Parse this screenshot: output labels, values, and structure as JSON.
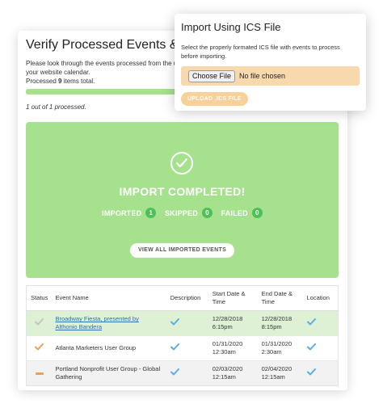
{
  "main": {
    "title": "Verify Processed Events & Import",
    "intro_line1": "Please look through the events processed from the uplo",
    "intro_line2": "your website calendar.",
    "processed_prefix": "Processed ",
    "processed_count": "9",
    "processed_suffix": " items total.",
    "progress_fraction": 1.0,
    "processed_status": "1 out of 1 processed."
  },
  "complete": {
    "title": "IMPORT COMPLETED!",
    "imported_label": "IMPORTED",
    "imported_count": "1",
    "skipped_label": "SKIPPED",
    "skipped_count": "0",
    "failed_label": "FAILED",
    "failed_count": "0",
    "view_button": "VIEW ALL IMPORTED EVENTS",
    "check_icon": "check-circle-icon"
  },
  "table": {
    "headers": {
      "status": "Status",
      "event_name": "Event Name",
      "description": "Description",
      "start_line1": "Start Date &",
      "start_line2": "Time",
      "end_line1": "End Date &",
      "end_line2": "Time",
      "location": "Location"
    },
    "rows": [
      {
        "status_icon": "check-icon",
        "name_line1": "Broadway Fiesta, presented by",
        "name_line2": "Althonio Bandera",
        "start_date": "12/28/2018",
        "start_time": "6:15pm",
        "end_date": "12/28/2018",
        "end_time": "8:15pm"
      },
      {
        "status_icon": "check-icon",
        "name_line1": "Atlanta Marketers User Group",
        "name_line2": "",
        "start_date": "01/31/2020",
        "start_time": "12:30am",
        "end_date": "01/31/2020",
        "end_time": "2:30am"
      },
      {
        "status_icon": "dash-icon",
        "name_line1": "Portland Nonprofit User Group - Global",
        "name_line2": "Gathering",
        "start_date": "02/03/2020",
        "start_time": "12:15am",
        "end_date": "02/04/2020",
        "end_time": "12:15am"
      }
    ]
  },
  "ics": {
    "title": "Import Using ICS File",
    "description": "Select the properly formated ICS file with events to process before importing.",
    "choose_button": "Choose File",
    "no_file": "No file chosen",
    "upload_button": "UPLOAD .ICS FILE"
  },
  "colors": {
    "success_green": "#a6e28d",
    "badge_green": "#4fbf5a",
    "check_blue": "#5aaee6",
    "warning_orange": "#f0a050",
    "upload_peach": "#f8d09a"
  }
}
